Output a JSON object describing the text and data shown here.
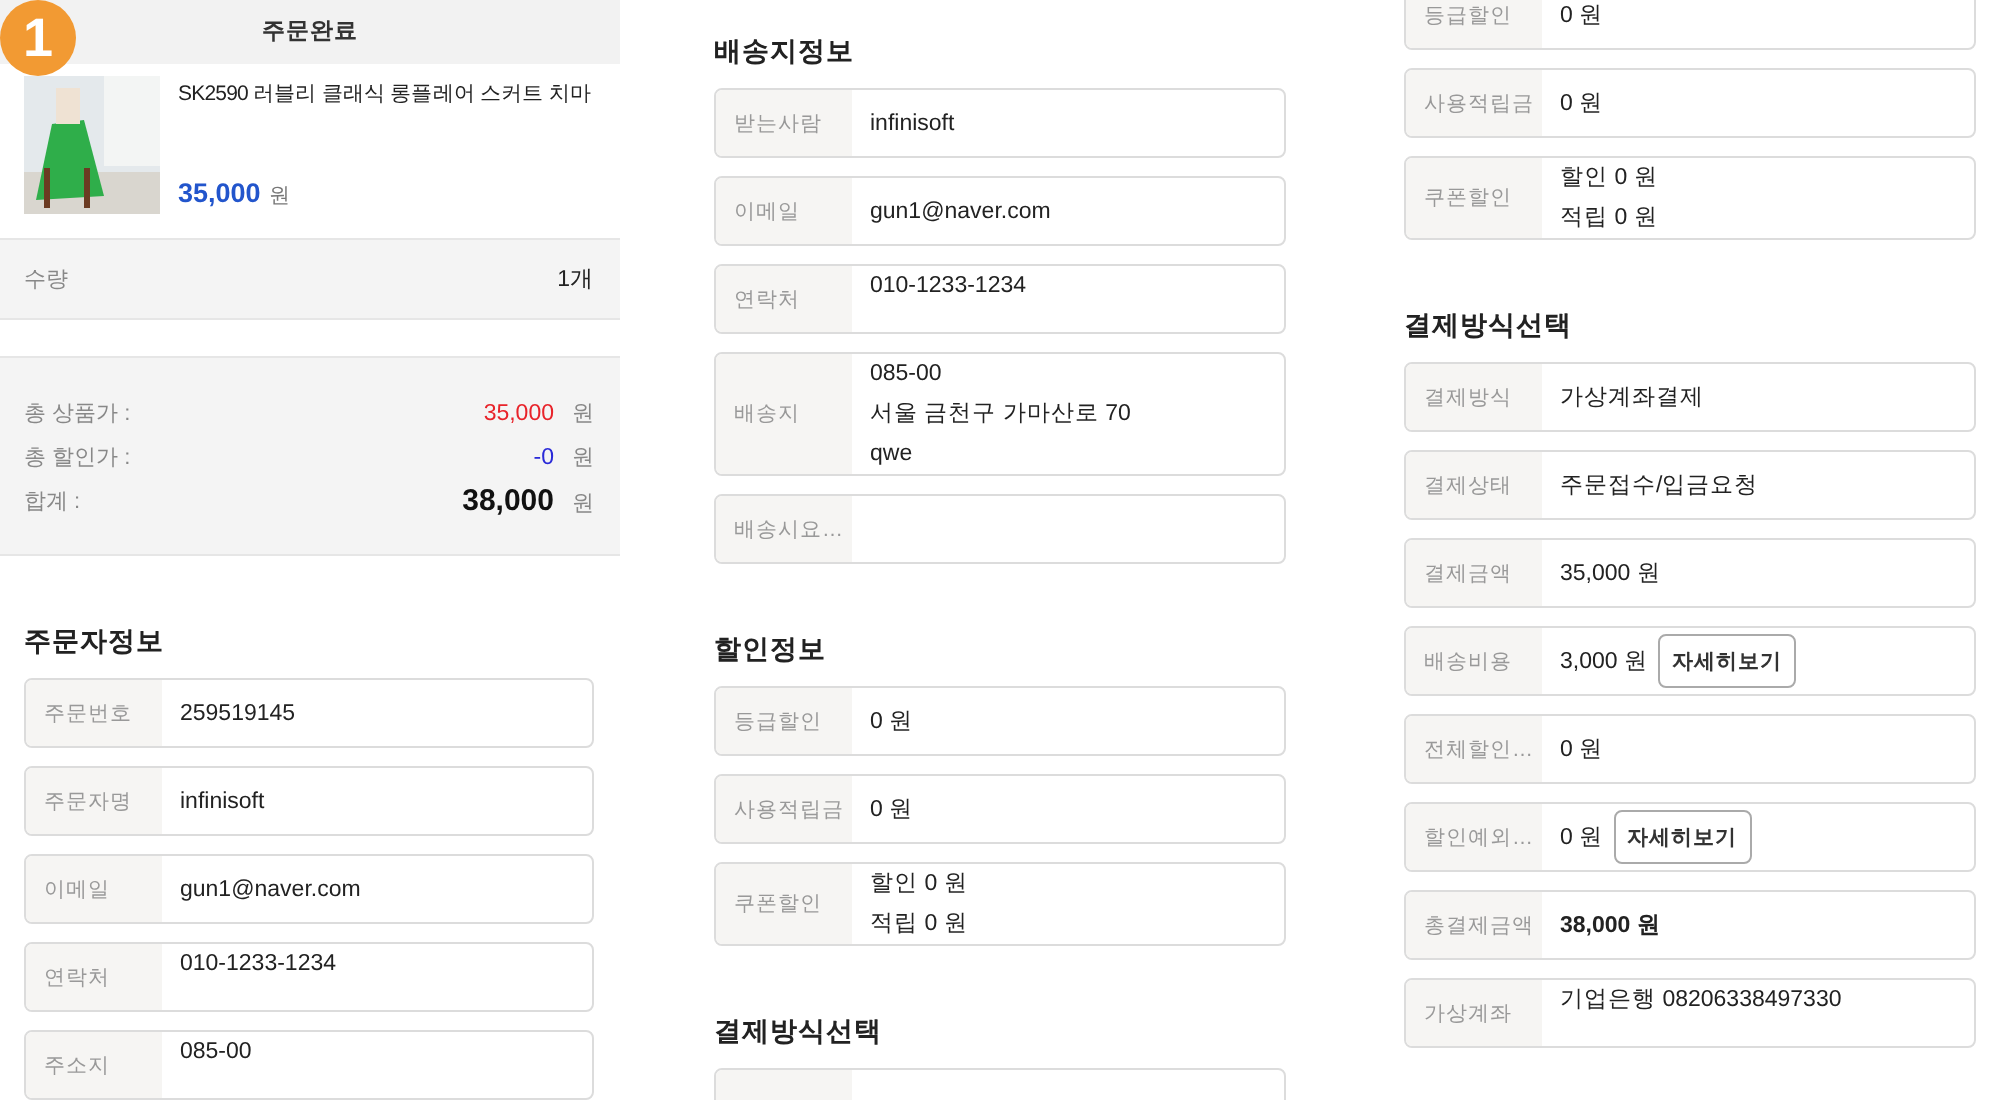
{
  "badge": "1",
  "order_panel": {
    "header": "주문완료",
    "product": {
      "name": "SK2590 러블리 클래식 롱플레어 스커트 치마",
      "price": "35,000",
      "unit": "원"
    },
    "quantity": {
      "label": "수량",
      "value": "1개"
    },
    "totals": [
      {
        "kind": "product",
        "label": "총 상품가 :",
        "amount": "35,000",
        "unit": "원"
      },
      {
        "kind": "discount",
        "label": "총 할인가 :",
        "amount": "-0",
        "unit": "원"
      },
      {
        "kind": "sum",
        "label": "합계 :",
        "amount": "38,000",
        "unit": "원"
      }
    ],
    "sections": [
      {
        "heading": "주문자정보",
        "rows": [
          {
            "kind": "text",
            "label": "주문번호",
            "value": "259519145"
          },
          {
            "kind": "text",
            "label": "주문자명",
            "value": "infinisoft"
          },
          {
            "kind": "text",
            "label": "이메일",
            "value": "gun1@naver.com"
          },
          {
            "kind": "lines",
            "label": "연락처",
            "lines": [
              "010-1233-1234"
            ]
          },
          {
            "kind": "lines",
            "label": "주소지",
            "lines": [
              "085-00"
            ]
          }
        ]
      }
    ]
  },
  "panels": [
    {
      "sections": [
        {
          "heading": "배송지정보",
          "rows": [
            {
              "kind": "text",
              "label": "받는사람",
              "value": "infinisoft"
            },
            {
              "kind": "text",
              "label": "이메일",
              "value": "gun1@naver.com"
            },
            {
              "kind": "lines",
              "label": "연락처",
              "lines": [
                "010-1233-1234"
              ]
            },
            {
              "kind": "lines",
              "label": "배송지",
              "lines": [
                "085-00",
                "서울 금천구 가마산로 70",
                "qwe"
              ]
            },
            {
              "kind": "text",
              "label": "배송시요…"
            }
          ]
        },
        {
          "heading": "할인정보",
          "rows": [
            {
              "kind": "text",
              "label": "등급할인",
              "value": "0 원"
            },
            {
              "kind": "text",
              "label": "사용적립금",
              "value": "0 원"
            },
            {
              "kind": "lines",
              "label": "쿠폰할인",
              "lines": [
                "할인 0 원",
                "적립 0 원"
              ]
            }
          ]
        },
        {
          "heading": "결제방식선택",
          "rows": [
            {
              "kind": "cut"
            }
          ]
        }
      ]
    },
    {
      "sections": [
        {
          "rows": [
            {
              "kind": "text",
              "label": "등급할인",
              "value": "0 원"
            },
            {
              "kind": "text",
              "label": "사용적립금",
              "value": "0 원"
            },
            {
              "kind": "lines",
              "label": "쿠폰할인",
              "lines": [
                "할인 0 원",
                "적립 0 원"
              ]
            }
          ]
        },
        {
          "heading": "결제방식선택",
          "rows": [
            {
              "kind": "text",
              "label": "결제방식",
              "value": "가상계좌결제"
            },
            {
              "kind": "text",
              "label": "결제상태",
              "value": "주문접수/입금요청"
            },
            {
              "kind": "text",
              "label": "결제금액",
              "value": "35,000 원"
            },
            {
              "kind": "button",
              "label": "배송비용",
              "value": "3,000 원",
              "button": "자세히보기"
            },
            {
              "kind": "text",
              "label": "전체할인…",
              "value": "0 원"
            },
            {
              "kind": "button",
              "label": "할인예외…",
              "value": "0 원",
              "button": "자세히보기"
            },
            {
              "kind": "total",
              "label": "총결제금액",
              "value": "38,000 원"
            },
            {
              "kind": "lines",
              "label": "가상계좌",
              "lines": [
                "기업은행 08206338497330"
              ]
            }
          ]
        }
      ]
    }
  ]
}
